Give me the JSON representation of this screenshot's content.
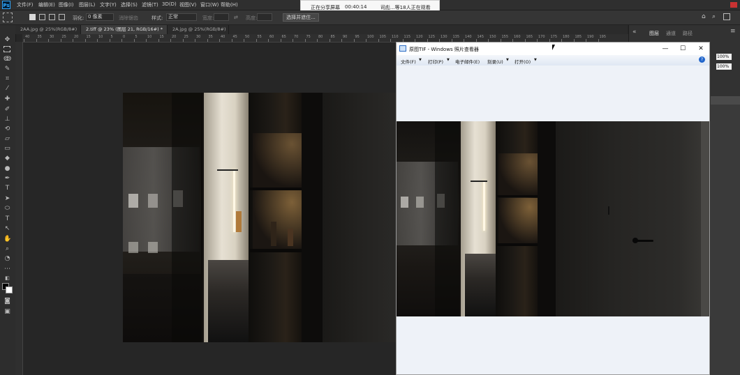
{
  "app": {
    "logo": "Ps",
    "menu": [
      "文件(F)",
      "编辑(E)",
      "图像(I)",
      "图层(L)",
      "文字(Y)",
      "选择(S)",
      "滤镜(T)",
      "3D(D)",
      "视图(V)",
      "窗口(W)",
      "帮助(H)"
    ]
  },
  "options_bar": {
    "feather_label": "羽化:",
    "feather_value": "0 像素",
    "antialias_label": "消除锯齿",
    "style_label": "样式:",
    "style_value": "正常",
    "width_label": "宽度:",
    "height_label": "高度:",
    "select_mask_button": "选择并遮住..."
  },
  "share_banner": {
    "status": "正在分享屏幕",
    "timer": "00:40:14",
    "viewers": "司彪...等18人正在观看"
  },
  "tabs": [
    {
      "label": "2AA.jpg @ 25%(RGB/8#)",
      "active": false
    },
    {
      "label": "2.tiff @ 23% (图层 21, RGB/16#) *",
      "active": true
    },
    {
      "label": "2A.jpg @ 25%(RGB/8#)",
      "active": false
    }
  ],
  "ruler": {
    "ticks": [
      "40",
      "35",
      "30",
      "25",
      "20",
      "15",
      "10",
      "5",
      "0",
      "5",
      "10",
      "15",
      "20",
      "25",
      "30",
      "35",
      "40",
      "45",
      "50",
      "55",
      "60",
      "65",
      "70",
      "75",
      "80",
      "85",
      "90",
      "95",
      "100",
      "105",
      "110",
      "115",
      "120",
      "125",
      "130",
      "135",
      "140",
      "145",
      "150",
      "155",
      "160",
      "165",
      "170",
      "175",
      "180",
      "185",
      "190",
      "195"
    ]
  },
  "right_panel": {
    "tabs": [
      "图层",
      "通道",
      "路径"
    ],
    "opacity": "100%",
    "fill": "100%"
  },
  "viewer": {
    "title": "原图TIF - Windows 照片查看器",
    "menu": [
      "文件(F)",
      "打印(P)",
      "电子邮件(E)",
      "刻录(U)",
      "打开(O)"
    ],
    "help": "?",
    "minimize": "—",
    "maximize": "☐",
    "close": "✕"
  },
  "colors": {
    "accent": "#31a8ff",
    "ps_bg": "#262626",
    "viewer_bg": "#eef2f8"
  }
}
